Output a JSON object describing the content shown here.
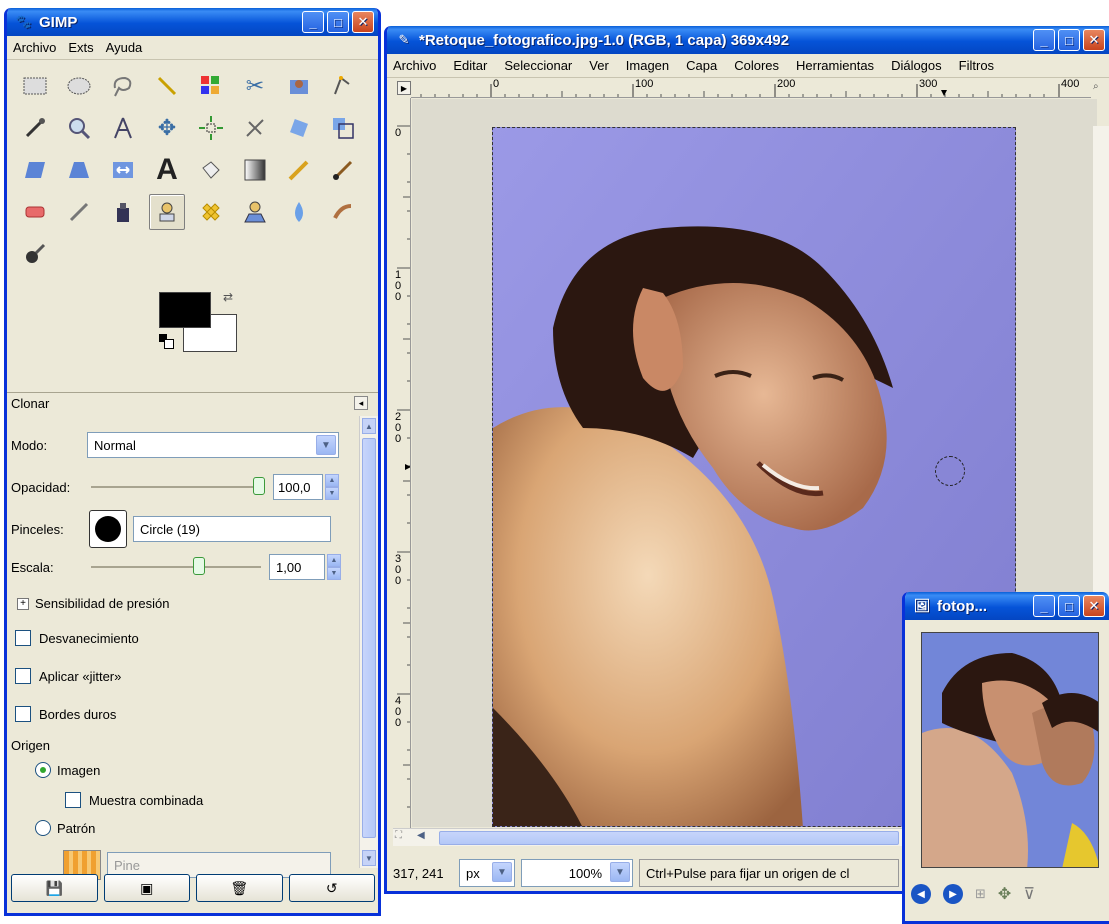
{
  "toolbox": {
    "title": "GIMP",
    "menu": [
      "Archivo",
      "Exts",
      "Ayuda"
    ],
    "tool_icons": [
      "rect-select-icon",
      "ellipse-select-icon",
      "lasso-icon",
      "fuzzy-select-icon",
      "color-select-icon",
      "scissors-icon",
      "foreground-select-icon",
      "paths-icon",
      "color-picker-icon",
      "zoom-icon",
      "measure-icon",
      "move-icon",
      "align-icon",
      "crop-icon",
      "rotate-icon",
      "scale-icon",
      "shear-icon",
      "perspective-icon",
      "flip-icon",
      "text-icon",
      "bucket-fill-icon",
      "blend-icon",
      "pencil-icon",
      "paintbrush-icon",
      "eraser-icon",
      "airbrush-icon",
      "ink-icon",
      "clone-icon",
      "heal-icon",
      "perspective-clone-icon",
      "blur-icon",
      "smudge-icon",
      "dodge-burn-icon"
    ],
    "colors": {
      "foreground": "#000000",
      "background": "#ffffff"
    },
    "options": {
      "title": "Clonar",
      "mode_label": "Modo:",
      "mode_value": "Normal",
      "opacity_label": "Opacidad:",
      "opacity_value": "100,0",
      "brushes_label": "Pinceles:",
      "brush_name": "Circle (19)",
      "scale_label": "Escala:",
      "scale_value": "1,00",
      "pressure_label": "Sensibilidad de presión",
      "fade_label": "Desvanecimiento",
      "jitter_label": "Aplicar «jitter»",
      "hard_label": "Bordes duros",
      "origin_label": "Origen",
      "image_label": "Imagen",
      "sample_label": "Muestra combinada",
      "pattern_label": "Patrón",
      "pattern_name": "Pine"
    }
  },
  "image_window": {
    "title": "*Retoque_fotografico.jpg-1.0 (RGB, 1 capa) 369x492",
    "menu": [
      "Archivo",
      "Editar",
      "Seleccionar",
      "Ver",
      "Imagen",
      "Capa",
      "Colores",
      "Herramientas",
      "Diálogos",
      "Filtros"
    ],
    "ruler_h": [
      "0",
      "100",
      "200",
      "300",
      "400"
    ],
    "ruler_v": [
      "0",
      "1\n0\n0",
      "2\n0\n0",
      "3\n0\n0",
      "4\n0\n0"
    ],
    "coords": "317, 241",
    "unit": "px",
    "zoom": "100%",
    "status_message": "Ctrl+Pulse para fijar un origen de cl"
  },
  "nav_window": {
    "title": "fotop..."
  }
}
